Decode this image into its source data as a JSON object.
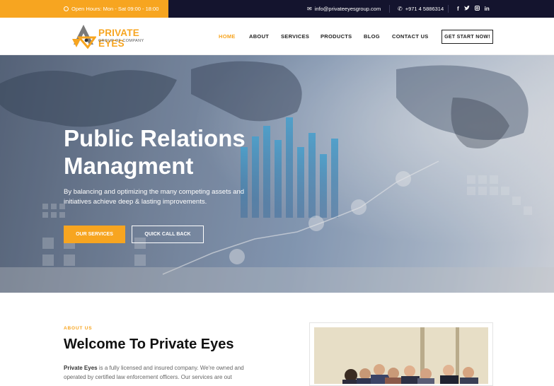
{
  "topbar": {
    "hours": "Open Hours: Mon - Sat 09:00 - 18:00",
    "email": "info@privateeyesgroup.com",
    "phone": "+971 4 5886314",
    "socials": [
      "f",
      "t",
      "ig",
      "in"
    ]
  },
  "brand": {
    "name": "PRIVATE EYES",
    "tagline": "GROUP OF COMPANY",
    "accent": "#f7a520"
  },
  "nav": {
    "items": [
      "HOME",
      "ABOUT",
      "SERVICES",
      "PRODUCTS",
      "BLOG",
      "CONTACT US"
    ],
    "active": "HOME",
    "cta": "GET START NOW!"
  },
  "hero": {
    "title_line1": "Public Relations",
    "title_line2": "Managment",
    "text": "By balancing and optimizing the many competing assets and initiatives achieve deep & lasting improvements.",
    "primary_button": "OUR SERVICES",
    "secondary_button": "QUICK CALL BACK"
  },
  "about": {
    "tag": "ABOUT US",
    "title": "Welcome To Private Eyes",
    "lead": "Private Eyes",
    "text": " is a fully licensed and insured company. We're owned and operated by certified law enforcement officers. Our services are out"
  },
  "colors": {
    "topbar_bg": "#14142e",
    "accent": "#f7a520"
  }
}
